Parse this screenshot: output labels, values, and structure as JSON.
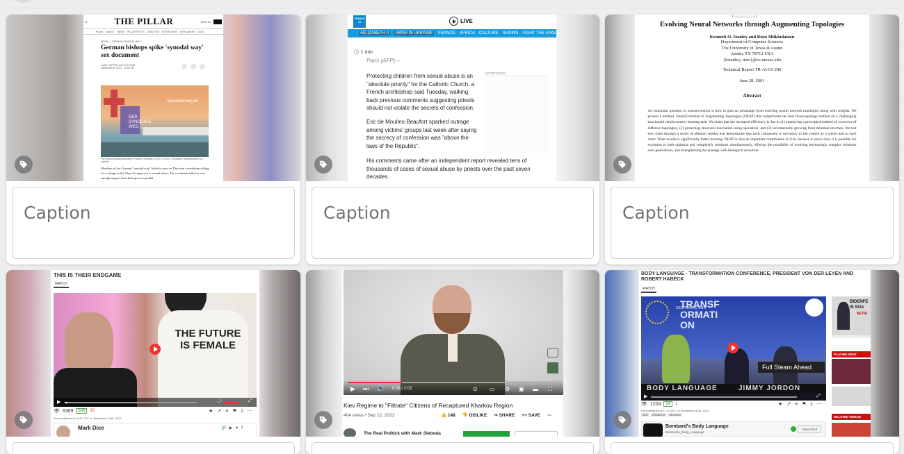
{
  "caption_placeholder": "Caption",
  "cards": [
    {
      "site": "THE PILLAR",
      "nav": [
        "HOME",
        "ABOUT",
        "NEWS",
        "PILLAR POSTS",
        "ANALYSIS",
        "INTERVIEWS",
        "EXPLAINERS",
        "DATA"
      ],
      "sign_in": "SIGN IN",
      "kicker": "NEWS — GERMAN SYNODAL WAY",
      "headline": "German bishops spike 'synodal way' sex document",
      "byline": "LUKE COPPEN and JD FLYNN",
      "date": "September 8, 2022 - 10:30 PM",
      "image_text_1": "DER SYNODALE WEG",
      "image_text_2": "synodalerweg.de",
      "photo_caption": "The second synodal assembly in Frankfurt, Germany, on Oct. 1, 2021. © Synodaler Weg/Maximilian von Lachner.",
      "body": "Members of the German \"synodal way\" failed to pass on Thursday a resolution calling for a change in the Church's approach to sexual ethics. The resolution failed to win enough support from bishops at a synodal"
    },
    {
      "channel": "FRANCE 24",
      "live": "LIVE",
      "nav": [
        "#ELIZABETH II",
        "#WAR IN UKRAINE",
        "FRANCE",
        "AFRICA",
        "CULTURE",
        "SHOWS",
        "FIGHT THE FAKE"
      ],
      "read_time": "1 min",
      "dateline": "Paris (AFP) –",
      "advertising": "ADVERTISING",
      "p1": "Protecting children from sexual abuse is an \"absolute priority\" for the Catholic Church, a French archbishop said Tuesday, walking back previous comments suggesting priests should not violate the secrets of confession.",
      "p2": "Eric de Moulins-Beaufort sparked outrage among victims' groups last week after saying the secrecy of confession was \"above the laws of the Republic\".",
      "p3": "His comments came after an independent report revealed tens of thousands of cases of sexual abuse by priests over the past seven decades."
    },
    {
      "title": "Evolving Neural Networks through Augmenting Topologies",
      "authors": "Kenneth O. Stanley and Risto Miikkulainen",
      "dept": "Department of Computer Sciences",
      "univ": "The University of Texas at Austin",
      "city": "Austin, TX 78712 USA",
      "email": "{kstanley, risto}@cs.utexas.edu",
      "report": "Technical Report TR-AI-01-290",
      "date": "June 28, 2001",
      "abstract_title": "Abstract",
      "abstract": "An important question in neuroevolution is how to gain an advantage from evolving neural network topologies along with weights. We present a method, NeuroEvolution of Augmenting Topologies (NEAT) that outperforms the best fixed-topology method on a challenging benchmark reinforcement learning task. We claim that the increased efficiency is due to (1) employing a principled method of crossover of different topologies, (2) protecting structural innovation using speciation, and (3) incrementally growing from minimal structure. We test this claim through a series of ablation studies that demonstrate that each component is necessary to the system as a whole and to each other. What results is significantly faster learning. NEAT is also an important contribution to GAs because it shows how it is possible for evolution to both optimize and complexify solutions simultaneously, offering the possibility of evolving increasingly complex solutions over generations, and strengthening the analogy with biological evolution."
    },
    {
      "title": "THIS IS THEIR ENDGAME",
      "watch_tab": "WATCH",
      "shirt_text": "THE FUTURE IS FEMALE",
      "views": "6369",
      "likes": "636",
      "dislikes": "20",
      "published": "First published at 14:41 UTC on September 10th, 2022.",
      "channel": "Mark Dice"
    },
    {
      "time": "0:28 / 2:02",
      "title": "Kiev Regime to \"Filtrate\" Citizens of Recaptured Kharkov Region",
      "meta": "404 views • Sep 12, 2022",
      "likes": "148",
      "dislike": "DISLIKE",
      "share": "SHARE",
      "save": "SAVE",
      "channel": "The Real Politick with Mark Sleboda"
    },
    {
      "title": "BODY LANGUAGE - TRANSFORMATION CONFERENCE, PRESIDENT VON DER LEYEN AND ROBERT HABECK",
      "watch_tab": "WATCH",
      "banner_big": "TRANSFORMATION",
      "banner_small": "GESPRÄCHE ZUR",
      "full_steam": "Full Steam Ahead",
      "body_language": "BODY LANGUAGE",
      "presenter": "JIMMY JORDON",
      "views": "1204",
      "likes": "54",
      "dislikes": "1",
      "published": "First published at 17:24 UTC on September 12th, 2022.",
      "tags": [
        "#EU",
        "#HABECK",
        "#EU2022"
      ],
      "channel": "Bombard's Body Language",
      "handle": "Bombards_Body_Language",
      "subscribed": "Subscribed",
      "side_title": "BIDENFE IS SOA",
      "side_sub": "RETIR",
      "playing_next": "PLAYING NEXT",
      "related": "RELATED VIDEOS"
    }
  ]
}
